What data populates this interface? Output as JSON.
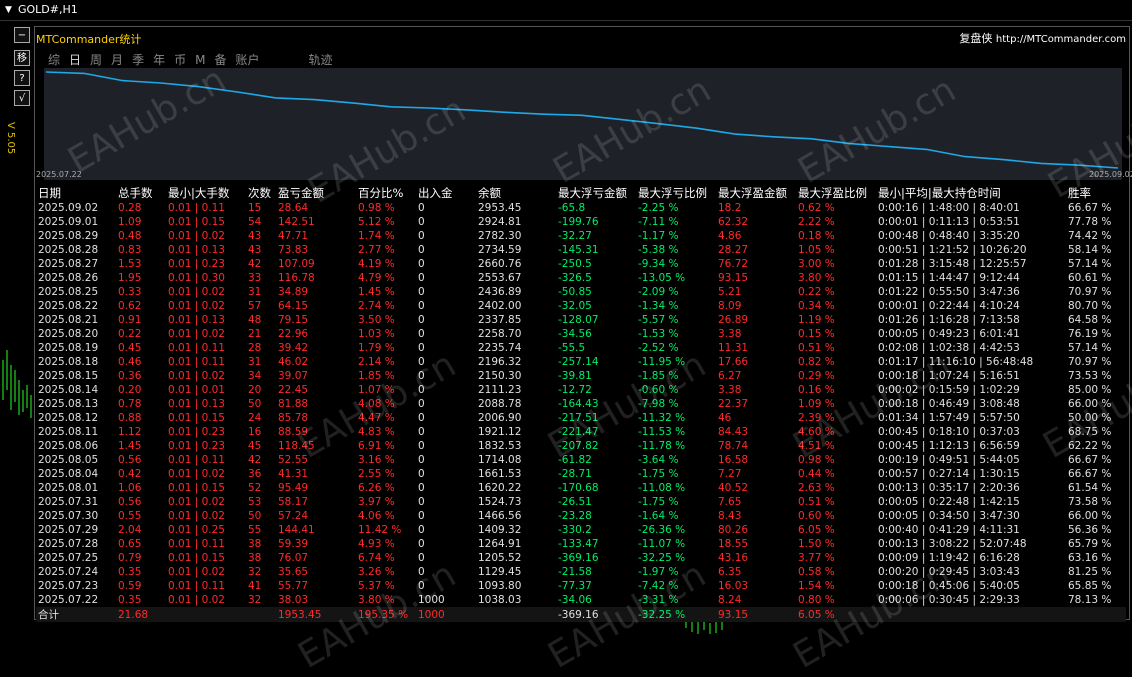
{
  "window": {
    "symbol": "GOLD#,H1",
    "version": "V 5.05"
  },
  "sidebar_buttons": [
    "−",
    "移",
    "?",
    "√"
  ],
  "panel": {
    "title": "MTCommander统计",
    "brand": "复盘侠",
    "url": "http://MTCommander.com",
    "tabs": [
      "综",
      "日",
      "周",
      "月",
      "季",
      "年",
      "币",
      "M",
      "备",
      "账户",
      "轨迹"
    ],
    "active_tab": "日"
  },
  "equity_chart": {
    "type": "line",
    "start_label": "2025.07.22",
    "end_label": "2025.09.02",
    "values": [
      1038.03,
      1093.8,
      1129.45,
      1205.52,
      1264.91,
      1409.32,
      1466.56,
      1524.73,
      1620.22,
      1661.53,
      1714.08,
      1832.53,
      1921.12,
      2006.9,
      2088.78,
      2111.23,
      2150.3,
      2196.32,
      2235.74,
      2258.7,
      2337.85,
      2402.0,
      2436.89,
      2553.67,
      2660.76,
      2734.59,
      2782.3,
      2924.81,
      2953.45
    ],
    "colors": {
      "line": "#1ea8e8",
      "background": "#1e2228"
    }
  },
  "table": {
    "headers": [
      "日期",
      "总手数",
      "最小|大手数",
      "次数",
      "盈亏金额",
      "百分比%",
      "出入金",
      "余额",
      "最大浮亏金额",
      "最大浮亏比例",
      "最大浮盈金额",
      "最大浮盈比例",
      "最小|平均|最大持仓时间",
      "胜率"
    ],
    "rows": [
      [
        "2025.09.02",
        "0.28",
        "0.01 | 0.11",
        "15",
        "28.64",
        "0.98 %",
        "0",
        "2953.45",
        "-65.8",
        "-2.25 %",
        "18.2",
        "0.62 %",
        "0:00:16 | 1:48:00 | 8:40:01",
        "66.67 %"
      ],
      [
        "2025.09.01",
        "1.09",
        "0.01 | 0.15",
        "54",
        "142.51",
        "5.12 %",
        "0",
        "2924.81",
        "-199.76",
        "-7.11 %",
        "62.32",
        "2.22 %",
        "0:00:01 | 0:11:13 | 0:53:51",
        "77.78 %"
      ],
      [
        "2025.08.29",
        "0.48",
        "0.01 | 0.02",
        "43",
        "47.71",
        "1.74 %",
        "0",
        "2782.30",
        "-32.27",
        "-1.17 %",
        "4.86",
        "0.18 %",
        "0:00:48 | 0:48:40 | 3:35:20",
        "74.42 %"
      ],
      [
        "2025.08.28",
        "0.83",
        "0.01 | 0.13",
        "43",
        "73.83",
        "2.77 %",
        "0",
        "2734.59",
        "-145.31",
        "-5.38 %",
        "28.27",
        "1.05 %",
        "0:00:51 | 1:21:52 | 10:26:20",
        "58.14 %"
      ],
      [
        "2025.08.27",
        "1.53",
        "0.01 | 0.23",
        "42",
        "107.09",
        "4.19 %",
        "0",
        "2660.76",
        "-250.5",
        "-9.34 %",
        "76.72",
        "3.00 %",
        "0:01:28 | 3:15:48 | 12:25:57",
        "57.14 %"
      ],
      [
        "2025.08.26",
        "1.95",
        "0.01 | 0.30",
        "33",
        "116.78",
        "4.79 %",
        "0",
        "2553.67",
        "-326.5",
        "-13.05 %",
        "93.15",
        "3.80 %",
        "0:01:15 | 1:44:47 | 9:12:44",
        "60.61 %"
      ],
      [
        "2025.08.25",
        "0.33",
        "0.01 | 0.02",
        "31",
        "34.89",
        "1.45 %",
        "0",
        "2436.89",
        "-50.85",
        "-2.09 %",
        "5.21",
        "0.22 %",
        "0:01:22 | 0:55:50 | 3:47:36",
        "70.97 %"
      ],
      [
        "2025.08.22",
        "0.62",
        "0.01 | 0.02",
        "57",
        "64.15",
        "2.74 %",
        "0",
        "2402.00",
        "-32.05",
        "-1.34 %",
        "8.09",
        "0.34 %",
        "0:00:01 | 0:22:44 | 4:10:24",
        "80.70 %"
      ],
      [
        "2025.08.21",
        "0.91",
        "0.01 | 0.13",
        "48",
        "79.15",
        "3.50 %",
        "0",
        "2337.85",
        "-128.07",
        "-5.57 %",
        "26.89",
        "1.19 %",
        "0:01:26 | 1:16:28 | 7:13:58",
        "64.58 %"
      ],
      [
        "2025.08.20",
        "0.22",
        "0.01 | 0.02",
        "21",
        "22.96",
        "1.03 %",
        "0",
        "2258.70",
        "-34.56",
        "-1.53 %",
        "3.38",
        "0.15 %",
        "0:00:05 | 0:49:23 | 6:01:41",
        "76.19 %"
      ],
      [
        "2025.08.19",
        "0.45",
        "0.01 | 0.11",
        "28",
        "39.42",
        "1.79 %",
        "0",
        "2235.74",
        "-55.5",
        "-2.52 %",
        "11.31",
        "0.51 %",
        "0:02:08 | 1:02:38 | 4:42:53",
        "57.14 %"
      ],
      [
        "2025.08.18",
        "0.46",
        "0.01 | 0.11",
        "31",
        "46.02",
        "2.14 %",
        "0",
        "2196.32",
        "-257.14",
        "-11.95 %",
        "17.66",
        "0.82 %",
        "0:01:17 | 11:16:10 | 56:48:48",
        "70.97 %"
      ],
      [
        "2025.08.15",
        "0.36",
        "0.01 | 0.02",
        "34",
        "39.07",
        "1.85 %",
        "0",
        "2150.30",
        "-39.81",
        "-1.85 %",
        "6.27",
        "0.29 %",
        "0:00:18 | 1:07:24 | 5:16:51",
        "73.53 %"
      ],
      [
        "2025.08.14",
        "0.20",
        "0.01 | 0.01",
        "20",
        "22.45",
        "1.07 %",
        "0",
        "2111.23",
        "-12.72",
        "-0.60 %",
        "3.38",
        "0.16 %",
        "0:00:02 | 0:15:59 | 1:02:29",
        "85.00 %"
      ],
      [
        "2025.08.13",
        "0.78",
        "0.01 | 0.13",
        "50",
        "81.88",
        "4.08 %",
        "0",
        "2088.78",
        "-164.43",
        "-7.98 %",
        "22.37",
        "1.09 %",
        "0:00:18 | 0:46:49 | 3:08:48",
        "66.00 %"
      ],
      [
        "2025.08.12",
        "0.88",
        "0.01 | 0.15",
        "24",
        "85.78",
        "4.47 %",
        "0",
        "2006.90",
        "-217.51",
        "-11.32 %",
        "46",
        "2.39 %",
        "0:01:34 | 1:57:49 | 5:57:50",
        "50.00 %"
      ],
      [
        "2025.08.11",
        "1.12",
        "0.01 | 0.23",
        "16",
        "88.59",
        "4.83 %",
        "0",
        "1921.12",
        "-221.47",
        "-11.53 %",
        "84.43",
        "4.60 %",
        "0:00:45 | 0:18:10 | 0:37:03",
        "68.75 %"
      ],
      [
        "2025.08.06",
        "1.45",
        "0.01 | 0.23",
        "45",
        "118.45",
        "6.91 %",
        "0",
        "1832.53",
        "-207.82",
        "-11.78 %",
        "78.74",
        "4.51 %",
        "0:00:45 | 1:12:13 | 6:56:59",
        "62.22 %"
      ],
      [
        "2025.08.05",
        "0.56",
        "0.01 | 0.11",
        "42",
        "52.55",
        "3.16 %",
        "0",
        "1714.08",
        "-61.82",
        "-3.64 %",
        "16.58",
        "0.98 %",
        "0:00:19 | 0:49:51 | 5:44:05",
        "66.67 %"
      ],
      [
        "2025.08.04",
        "0.42",
        "0.01 | 0.02",
        "36",
        "41.31",
        "2.55 %",
        "0",
        "1661.53",
        "-28.71",
        "-1.75 %",
        "7.27",
        "0.44 %",
        "0:00:57 | 0:27:14 | 1:30:15",
        "66.67 %"
      ],
      [
        "2025.08.01",
        "1.06",
        "0.01 | 0.15",
        "52",
        "95.49",
        "6.26 %",
        "0",
        "1620.22",
        "-170.68",
        "-11.08 %",
        "40.52",
        "2.63 %",
        "0:00:13 | 0:35:17 | 2:20:36",
        "61.54 %"
      ],
      [
        "2025.07.31",
        "0.56",
        "0.01 | 0.02",
        "53",
        "58.17",
        "3.97 %",
        "0",
        "1524.73",
        "-26.51",
        "-1.75 %",
        "7.65",
        "0.51 %",
        "0:00:05 | 0:22:48 | 1:42:15",
        "73.58 %"
      ],
      [
        "2025.07.30",
        "0.55",
        "0.01 | 0.02",
        "50",
        "57.24",
        "4.06 %",
        "0",
        "1466.56",
        "-23.28",
        "-1.64 %",
        "8.43",
        "0.60 %",
        "0:00:05 | 0:34:50 | 3:47:30",
        "66.00 %"
      ],
      [
        "2025.07.29",
        "2.04",
        "0.01 | 0.25",
        "55",
        "144.41",
        "11.42 %",
        "0",
        "1409.32",
        "-330.2",
        "-26.36 %",
        "80.26",
        "6.05 %",
        "0:00:40 | 0:41:29 | 4:11:31",
        "56.36 %"
      ],
      [
        "2025.07.28",
        "0.65",
        "0.01 | 0.11",
        "38",
        "59.39",
        "4.93 %",
        "0",
        "1264.91",
        "-133.47",
        "-11.07 %",
        "18.55",
        "1.50 %",
        "0:00:13 | 3:08:22 | 52:07:48",
        "65.79 %"
      ],
      [
        "2025.07.25",
        "0.79",
        "0.01 | 0.15",
        "38",
        "76.07",
        "6.74 %",
        "0",
        "1205.52",
        "-369.16",
        "-32.25 %",
        "43.16",
        "3.77 %",
        "0:00:09 | 1:19:42 | 6:16:28",
        "63.16 %"
      ],
      [
        "2025.07.24",
        "0.35",
        "0.01 | 0.02",
        "32",
        "35.65",
        "3.26 %",
        "0",
        "1129.45",
        "-21.58",
        "-1.97 %",
        "6.35",
        "0.58 %",
        "0:00:20 | 0:29:45 | 3:03:43",
        "81.25 %"
      ],
      [
        "2025.07.23",
        "0.59",
        "0.01 | 0.11",
        "41",
        "55.77",
        "5.37 %",
        "0",
        "1093.80",
        "-77.37",
        "-7.42 %",
        "16.03",
        "1.54 %",
        "0:00:18 | 0:45:06 | 5:40:05",
        "65.85 %"
      ],
      [
        "2025.07.22",
        "0.35",
        "0.01 | 0.02",
        "32",
        "38.03",
        "3.80 %",
        "1000",
        "1038.03",
        "-34.06",
        "-3.31 %",
        "8.24",
        "0.80 %",
        "0:00:06 | 0:30:45 | 2:29:33",
        "78.13 %"
      ]
    ],
    "total": [
      "合计",
      "21.68",
      "",
      "",
      "1953.45",
      "195.35 %",
      "1000",
      "",
      "-369.16",
      "-32.25 %",
      "93.15",
      "6.05 %",
      "",
      ""
    ],
    "column_colors": [
      "w",
      "r",
      "r",
      "r",
      "r",
      "r",
      "w",
      "w",
      "g",
      "g",
      "r",
      "r",
      "w",
      "w"
    ],
    "total_colors": [
      "w",
      "r",
      "w",
      "w",
      "r",
      "r",
      "r",
      "w",
      "w",
      "g",
      "r",
      "r",
      "w",
      "w"
    ]
  },
  "watermark": "EAHub.cn"
}
